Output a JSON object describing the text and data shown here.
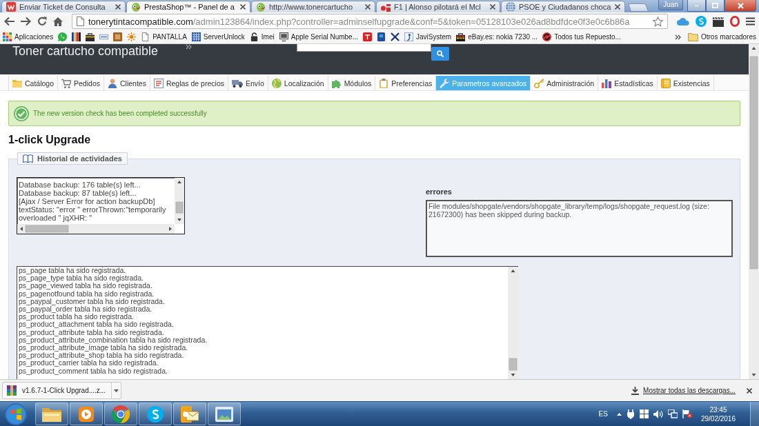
{
  "browser": {
    "tabs": [
      {
        "title": "Enviar Ticket de Consulta",
        "selected": false
      },
      {
        "title": "PrestaShop™ - Panel de a",
        "selected": true
      },
      {
        "title": "http://www.tonercartucho",
        "selected": false
      },
      {
        "title": "F1 | Alonso pilotará el Mcl",
        "selected": false
      },
      {
        "title": "PSOE y Ciudadanos choca",
        "selected": false
      }
    ],
    "profile": "Juan",
    "address": {
      "host": "tonerytintacompatible.com",
      "path": "/admin123864/index.php?controller=adminselfupgrade&conf=5&token=05128103e026ad8bdfdce0f3e0c6b86a"
    },
    "bookmarks": [
      {
        "kind": "link",
        "label": "Aplicaciones"
      },
      {
        "kind": "icon"
      },
      {
        "kind": "icon"
      },
      {
        "kind": "icon"
      },
      {
        "kind": "icon"
      },
      {
        "kind": "icon"
      },
      {
        "kind": "icon"
      },
      {
        "kind": "link",
        "label": "PANTALLA"
      },
      {
        "kind": "link",
        "label": "ServerUnlock"
      },
      {
        "kind": "link",
        "label": "Imei"
      },
      {
        "kind": "link",
        "label": "Apple Serial Numbe..."
      },
      {
        "kind": "icon"
      },
      {
        "kind": "icon"
      },
      {
        "kind": "icon"
      },
      {
        "kind": "link",
        "label": "JaviSystem"
      },
      {
        "kind": "link",
        "label": "eBay.es: nokia 7230 ..."
      },
      {
        "kind": "link",
        "label": "Todos tus Repuesto..."
      }
    ],
    "other_bookmarks": "Otros marcadores"
  },
  "shop_header": {
    "title": "Toner cartucho compatible"
  },
  "menu": [
    {
      "label": "Catálogo",
      "selected": false
    },
    {
      "label": "Pedidos",
      "selected": false
    },
    {
      "label": "Clientes",
      "selected": false
    },
    {
      "label": "Reglas de precios",
      "selected": false
    },
    {
      "label": "Envío",
      "selected": false
    },
    {
      "label": "Localización",
      "selected": false
    },
    {
      "label": "Módulos",
      "selected": false
    },
    {
      "label": "Preferencias",
      "selected": false
    },
    {
      "label": "Parametros avanzados",
      "selected": true
    },
    {
      "label": "Administración",
      "selected": false
    },
    {
      "label": "Estadísticas",
      "selected": false
    },
    {
      "label": "Existencias",
      "selected": false
    }
  ],
  "alert": {
    "kind": "success",
    "message": "The new version check has been completed successfully"
  },
  "page_title": "1-click Upgrade",
  "activity": {
    "legend": "Historial de actividades",
    "log": [
      "Database backup: 176 table(s) left...",
      "Database backup: 87 table(s) left...",
      "[Ajax / Server Error for action backupDb]",
      "textStatus: \"error \" errorThrown:\"temporarily",
      "overloaded \" jqXHR: \""
    ],
    "errors_label": "errores",
    "errors": "File modules/shopgate/vendors/shopgate_library/temp/logs/shopgate_request.log (size: 21672300) has been skipped during backup.",
    "tables_log": [
      "ps_page tabla ha sido registrada.",
      "ps_page_type tabla ha sido registrada.",
      "ps_page_viewed tabla ha sido registrada.",
      "ps_pagenotfound tabla ha sido registrada.",
      "ps_paypal_customer tabla ha sido registrada.",
      "ps_paypal_order tabla ha sido registrada.",
      "ps_product tabla ha sido registrada.",
      "ps_product_attachment tabla ha sido registrada.",
      "ps_product_attribute tabla ha sido registrada.",
      "ps_product_attribute_combination tabla ha sido registrada.",
      "ps_product_attribute_image tabla ha sido registrada.",
      "ps_product_attribute_shop tabla ha sido registrada.",
      "ps_product_carrier tabla ha sido registrada.",
      "ps_product_comment tabla ha sido registrada."
    ]
  },
  "downloads": {
    "file": "v1.6.7-1-Click Upgrad....z...",
    "show_all": "Mostrar todas las descargas..."
  },
  "taskbar": {
    "language": "ES",
    "time": "23:45",
    "date": "29/02/2016"
  }
}
